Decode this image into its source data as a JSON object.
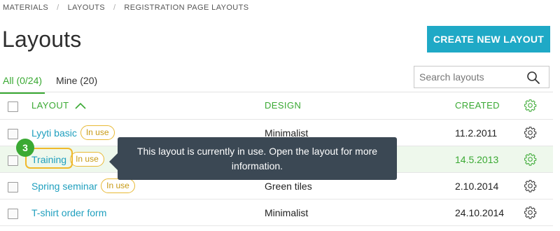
{
  "breadcrumb": {
    "items": [
      "MATERIALS",
      "LAYOUTS",
      "REGISTRATION PAGE LAYOUTS"
    ],
    "separator": "/"
  },
  "page": {
    "title": "Layouts",
    "create_button": "CREATE NEW LAYOUT"
  },
  "tabs": [
    {
      "label": "All (0/24)",
      "active": true
    },
    {
      "label": "Mine (20)",
      "active": false
    }
  ],
  "search": {
    "placeholder": "Search layouts",
    "value": ""
  },
  "table": {
    "headers": {
      "layout": "LAYOUT",
      "design": "DESIGN",
      "created": "CREATED"
    },
    "rows": [
      {
        "name": "Lyyti basic",
        "badge": "In use",
        "design": "Minimalist",
        "created": "11.2.2011"
      },
      {
        "name": "Training",
        "badge": "In use",
        "design": "",
        "created": "14.5.2013"
      },
      {
        "name": "Spring seminar",
        "badge": "In use",
        "design": "Green tiles",
        "created": "2.10.2014"
      },
      {
        "name": "T-shirt order form",
        "badge": "",
        "design": "Minimalist",
        "created": "24.10.2014"
      }
    ]
  },
  "tour": {
    "step": "3",
    "tooltip": "This layout is currently in use. Open the layout for more information."
  },
  "colors": {
    "accent_green": "#3aa933",
    "link_blue": "#1f9fbe",
    "button_blue": "#1fa9c6",
    "badge_yellow": "#e8b935",
    "tooltip_bg": "#3b4854"
  },
  "icons": {
    "sort": "chevron-up-icon",
    "search": "search-icon",
    "settings": "gear-icon"
  }
}
